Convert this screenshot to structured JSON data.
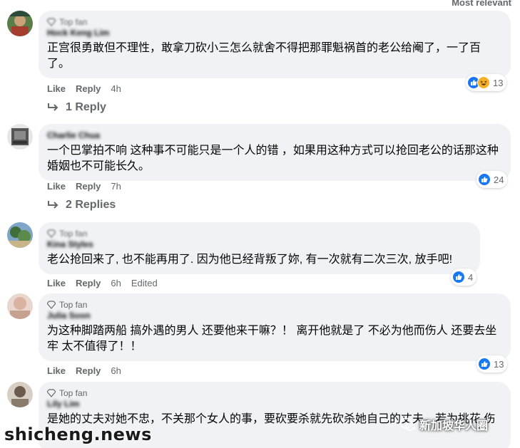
{
  "header": {
    "sort_label": "Most relevant"
  },
  "badge_label": "Top fan",
  "comments": [
    {
      "author": "Hock Keng Lim",
      "top_fan": true,
      "text": "正宫很勇敢但不理性，敢拿刀砍小三怎么就舍不得把那罪魁祸首的老公给阉了，一了百了。",
      "like": "Like",
      "reply": "Reply",
      "time": "4h",
      "reaction_count": "13",
      "reactions": [
        "like",
        "haha"
      ],
      "replies": "1 Reply"
    },
    {
      "author": "Charlie Chua",
      "top_fan": false,
      "text": "一个巴掌拍不响 这种事不可能只是一个人的错 ，如果用这种方式可以抢回老公的话那这种婚姻也不可能长久。",
      "like": "Like",
      "reply": "Reply",
      "time": "7h",
      "reaction_count": "24",
      "reactions": [
        "like"
      ],
      "replies": "2 Replies"
    },
    {
      "author": "Kina Styles",
      "top_fan": true,
      "text": "老公抢回来了, 也不能再用了. 因为他已经背叛了妳, 有一次就有二次三次, 放手吧!",
      "like": "Like",
      "reply": "Reply",
      "time": "6h",
      "edited": "Edited",
      "reaction_count": "4",
      "reactions": [
        "like"
      ]
    },
    {
      "author": "Julia Soon",
      "top_fan": true,
      "text": "为这种脚踏两船 搞外遇的男人 还要他来干嘛？！ 离开他就是了 不必为他而伤人 还要去坐牢 太不值得了！！",
      "like": "Like",
      "reply": "Reply",
      "time": "6h",
      "reaction_count": "13",
      "reactions": [
        "like"
      ]
    },
    {
      "author": "Lily Lim",
      "top_fan": true,
      "text": "是她的丈夫对她不忠，不关那个女人的事，要砍要杀就先砍杀她自己的丈夫，若为挑花 伤",
      "reactions": []
    }
  ],
  "watermarks": {
    "left": "shicheng.news",
    "right": "新加坡华人圈"
  },
  "colors": {
    "bubble": "#f0f2f5",
    "like_blue": "#1877f2",
    "meta_gray": "#65676b"
  }
}
